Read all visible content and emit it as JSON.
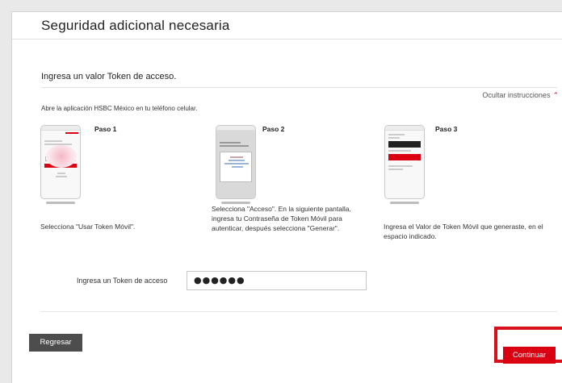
{
  "header": {
    "title": "Seguridad adicional necesaria"
  },
  "form": {
    "subtitle": "Ingresa un valor Token de acceso.",
    "hide_instructions": "Ocultar instrucciones",
    "intro": "Abre la aplicación HSBC México en tu teléfono celular.",
    "steps": [
      {
        "title": "Paso 1",
        "text": "Selecciona \"Usar Token Móvil\"."
      },
      {
        "title": "Paso 2",
        "text": "Selecciona \"Acceso\". En la siguiente pantalla, ingresa tu Contraseña de Token Móvil para autenticar, después selecciona \"Generar\"."
      },
      {
        "title": "Paso 3",
        "text": "Ingresa el Valor de Token Móvil que generaste, en el espacio indicado."
      }
    ],
    "token_label": "Ingresa un Token de acceso",
    "token_value": "●●●●●●"
  },
  "footer": {
    "back_label": "Regresar",
    "continue_label": "Continuar"
  },
  "icons": {
    "hide_instructions": "chevron-up-icon"
  },
  "colors": {
    "accent": "#db0011",
    "back_button": "#4d4d4d"
  }
}
